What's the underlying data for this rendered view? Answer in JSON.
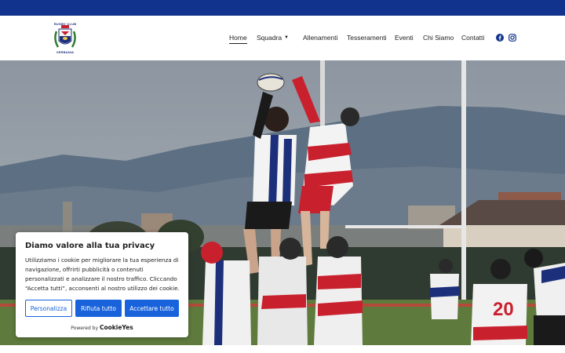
{
  "brand": {
    "logo_top_text": "RUGBY CLUB",
    "logo_bottom_text": "VERBANIA"
  },
  "nav": {
    "items": [
      {
        "label": "Home"
      },
      {
        "label": "Squadra"
      },
      {
        "label": "Allenamenti"
      },
      {
        "label": "Tesseramenti"
      },
      {
        "label": "Eventi"
      },
      {
        "label": "Chi Siamo"
      },
      {
        "label": "Contatti"
      }
    ],
    "social_icons": [
      "facebook-icon",
      "instagram-icon"
    ]
  },
  "hero": {
    "jersey_numbers": [
      "20"
    ]
  },
  "cookie_banner": {
    "title": "Diamo valore alla tua privacy",
    "body": "Utilizziamo i cookie per migliorare la tua esperienza di navigazione, offrirti pubblicità o contenuti personalizzati e analizzare il nostro traffico. Cliccando “Accetta tutti”, acconsenti al nostro utilizzo dei cookie.",
    "customize_label": "Personalizza",
    "reject_label": "Rifiuta tutto",
    "accept_label": "Accettare tutto",
    "powered_by": "Powered by",
    "powered_brand": "CookieYes"
  },
  "colors": {
    "topbar": "#12338d",
    "button_blue": "#1863dc",
    "jersey_red": "#c9202e"
  }
}
